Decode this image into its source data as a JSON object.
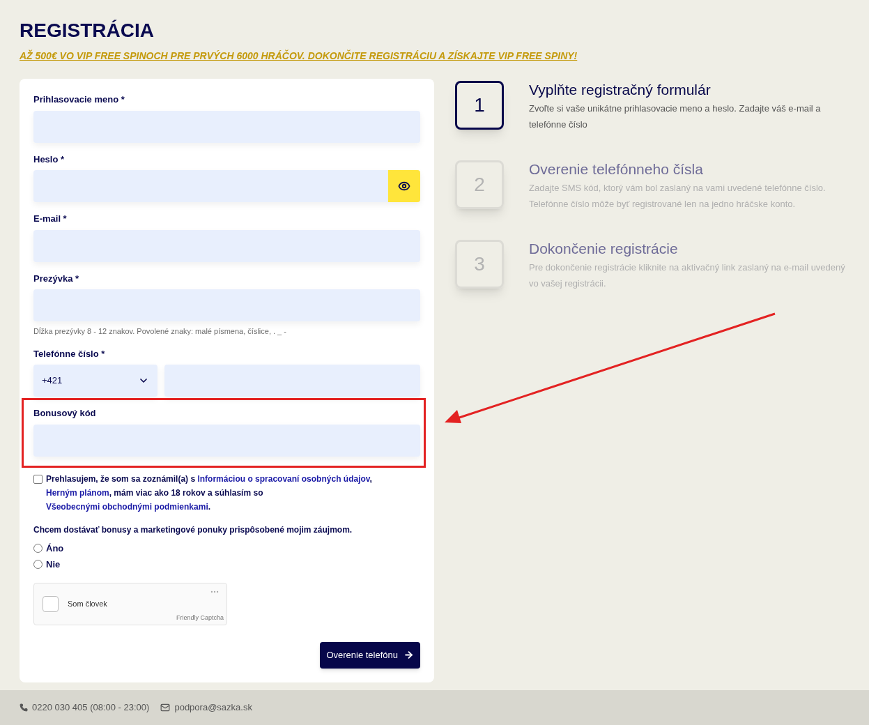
{
  "title": "REGISTRÁCIA",
  "promo": "AŽ 500€ VO VIP FREE SPINOCH PRE PRVÝCH 6000 HRÁČOV. DOKONČITE REGISTRÁCIU A ZÍSKAJTE VIP FREE SPINY!",
  "form": {
    "fields": [
      {
        "kind": "text",
        "label": "Prihlasovacie meno *"
      },
      {
        "kind": "password",
        "label": "Heslo *"
      },
      {
        "kind": "text",
        "label": "E-mail *"
      },
      {
        "kind": "text",
        "label": "Prezývka *",
        "hint": "Dĺžka prezývky 8 - 12 znakov. Povolené znaky: malé písmena, číslice, . _ -"
      },
      {
        "kind": "phone",
        "label": "Telefónne číslo *",
        "prefix": "+421"
      },
      {
        "kind": "text",
        "label": "Bonusový kód",
        "highlighted": true
      }
    ],
    "consent": {
      "checked": false,
      "parts": [
        {
          "kind": "text",
          "text": "Prehlasujem, že som sa zoznámil(a) s "
        },
        {
          "kind": "link",
          "text": "Informáciou o spracovaní osobných údajov"
        },
        {
          "kind": "text",
          "text": ", "
        },
        {
          "kind": "link",
          "text": "Herným plánom"
        },
        {
          "kind": "text",
          "text": ", mám viac ako 18 rokov a súhlasím so "
        },
        {
          "kind": "link",
          "text": "Všeobecnými obchodnými podmienkami"
        },
        {
          "kind": "text",
          "text": "."
        }
      ]
    },
    "marketing": {
      "question": "Chcem dostávať bonusy a marketingové ponuky prispôsobené mojim záujmom.",
      "options": [
        {
          "label": "Áno",
          "selected": false
        },
        {
          "label": "Nie",
          "selected": false
        }
      ]
    },
    "captcha": {
      "label": "Som človek",
      "brand": "Friendly Captcha",
      "checked": false
    },
    "submit": "Overenie telefónu"
  },
  "steps": [
    {
      "number": "1",
      "title": "Vyplňte registračný formulár",
      "text": "Zvoľte si vaše unikátne prihlasovacie meno a heslo. Zadajte váš e-mail a telefónne číslo",
      "active": true
    },
    {
      "number": "2",
      "title": "Overenie telefónneho čísla",
      "text": "Zadajte SMS kód, ktorý vám bol zaslaný na vami uvedené telefónne číslo. Telefónne číslo môže byť registrované len na jedno hráčske konto.",
      "active": false
    },
    {
      "number": "3",
      "title": "Dokončenie registrácie",
      "text": "Pre dokončenie registrácie kliknite na aktivačný link zaslaný na e-mail uvedený vo vašej registrácii.",
      "active": false
    }
  ],
  "footer": {
    "phone": "0220 030 405 (08:00 - 23:00)",
    "email": "podpora@sazka.sk"
  }
}
